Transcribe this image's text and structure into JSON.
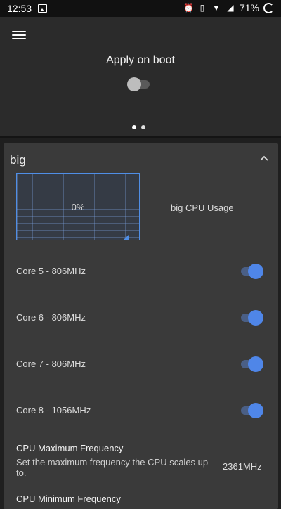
{
  "status_bar": {
    "time": "12:53",
    "battery": "71%"
  },
  "header": {
    "apply_on_boot_label": "Apply on boot",
    "apply_on_boot_enabled": false,
    "page_count": 2,
    "current_page": 1
  },
  "card": {
    "title": "big",
    "graph": {
      "value": "0%",
      "label": "big CPU Usage"
    },
    "cores": [
      {
        "label": "Core 5 - 806MHz",
        "enabled": true
      },
      {
        "label": "Core 6 - 806MHz",
        "enabled": true
      },
      {
        "label": "Core 7 - 806MHz",
        "enabled": true
      },
      {
        "label": "Core 8 - 1056MHz",
        "enabled": true
      }
    ],
    "max_freq": {
      "title": "CPU Maximum Frequency",
      "description": "Set the maximum frequency the CPU scales up to.",
      "value": "2361MHz"
    },
    "min_freq": {
      "title": "CPU Minimum Frequency"
    }
  },
  "colors": {
    "accent": "#4f86e8",
    "card_bg": "#3a3a3a",
    "header_bg": "#2b2b2b"
  }
}
